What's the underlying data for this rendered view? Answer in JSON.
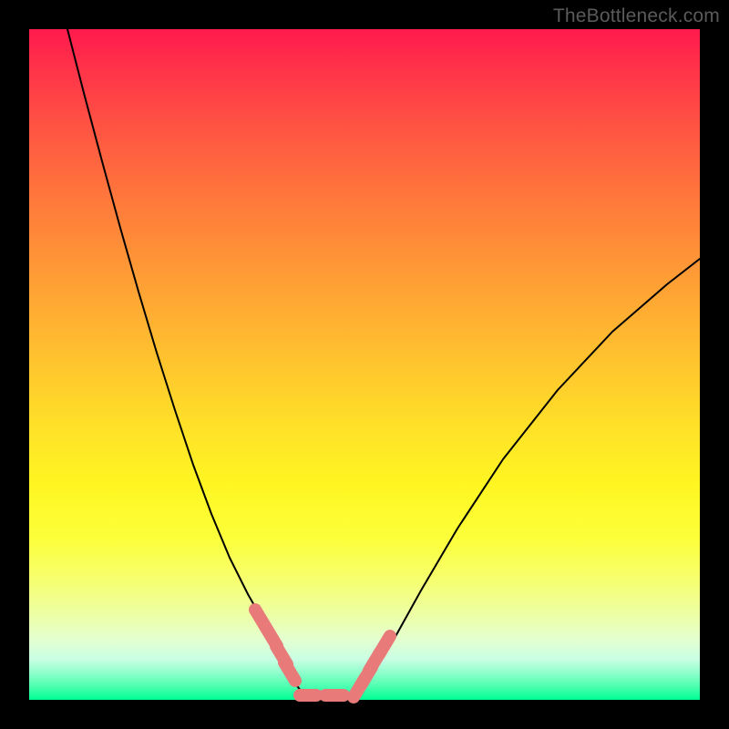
{
  "watermark": "TheBottleneck.com",
  "chart_data": {
    "type": "line",
    "title": "",
    "xlabel": "",
    "ylabel": "",
    "xlim": [
      0,
      736
    ],
    "ylim": [
      0,
      736
    ],
    "series": [
      {
        "name": "left-curve",
        "x": [
          42,
          60,
          80,
          100,
          120,
          140,
          160,
          180,
          200,
          220,
          240,
          260,
          270,
          278,
          285,
          292,
          298,
          303
        ],
        "y": [
          0,
          70,
          145,
          218,
          288,
          355,
          418,
          478,
          532,
          580,
          620,
          655,
          674,
          692,
          706,
          718,
          726,
          731
        ]
      },
      {
        "name": "bottom-flat",
        "x": [
          303,
          320,
          340,
          355
        ],
        "y": [
          731,
          733,
          733,
          731
        ]
      },
      {
        "name": "right-curve",
        "x": [
          355,
          365,
          380,
          400,
          430,
          470,
          520,
          580,
          640,
          700,
          736
        ],
        "y": [
          731,
          722,
          702,
          670,
          616,
          548,
          472,
          396,
          332,
          280,
          252
        ]
      }
    ],
    "markers": {
      "left_ticks": [
        {
          "x": 254,
          "y": 647
        },
        {
          "x": 266,
          "y": 667
        },
        {
          "x": 277,
          "y": 687
        },
        {
          "x": 286,
          "y": 705
        }
      ],
      "right_ticks": [
        {
          "x": 362,
          "y": 723
        },
        {
          "x": 370,
          "y": 710
        },
        {
          "x": 379,
          "y": 694
        },
        {
          "x": 390,
          "y": 676
        }
      ],
      "bottom_ticks": [
        {
          "x1": 297,
          "y1": 731,
          "x2": 315,
          "y2": 731
        },
        {
          "x1": 325,
          "y1": 731,
          "x2": 345,
          "y2": 731
        }
      ]
    },
    "background_gradient": {
      "top": "#ff1a4d",
      "mid": "#fff622",
      "bottom": "#00ff95"
    }
  }
}
